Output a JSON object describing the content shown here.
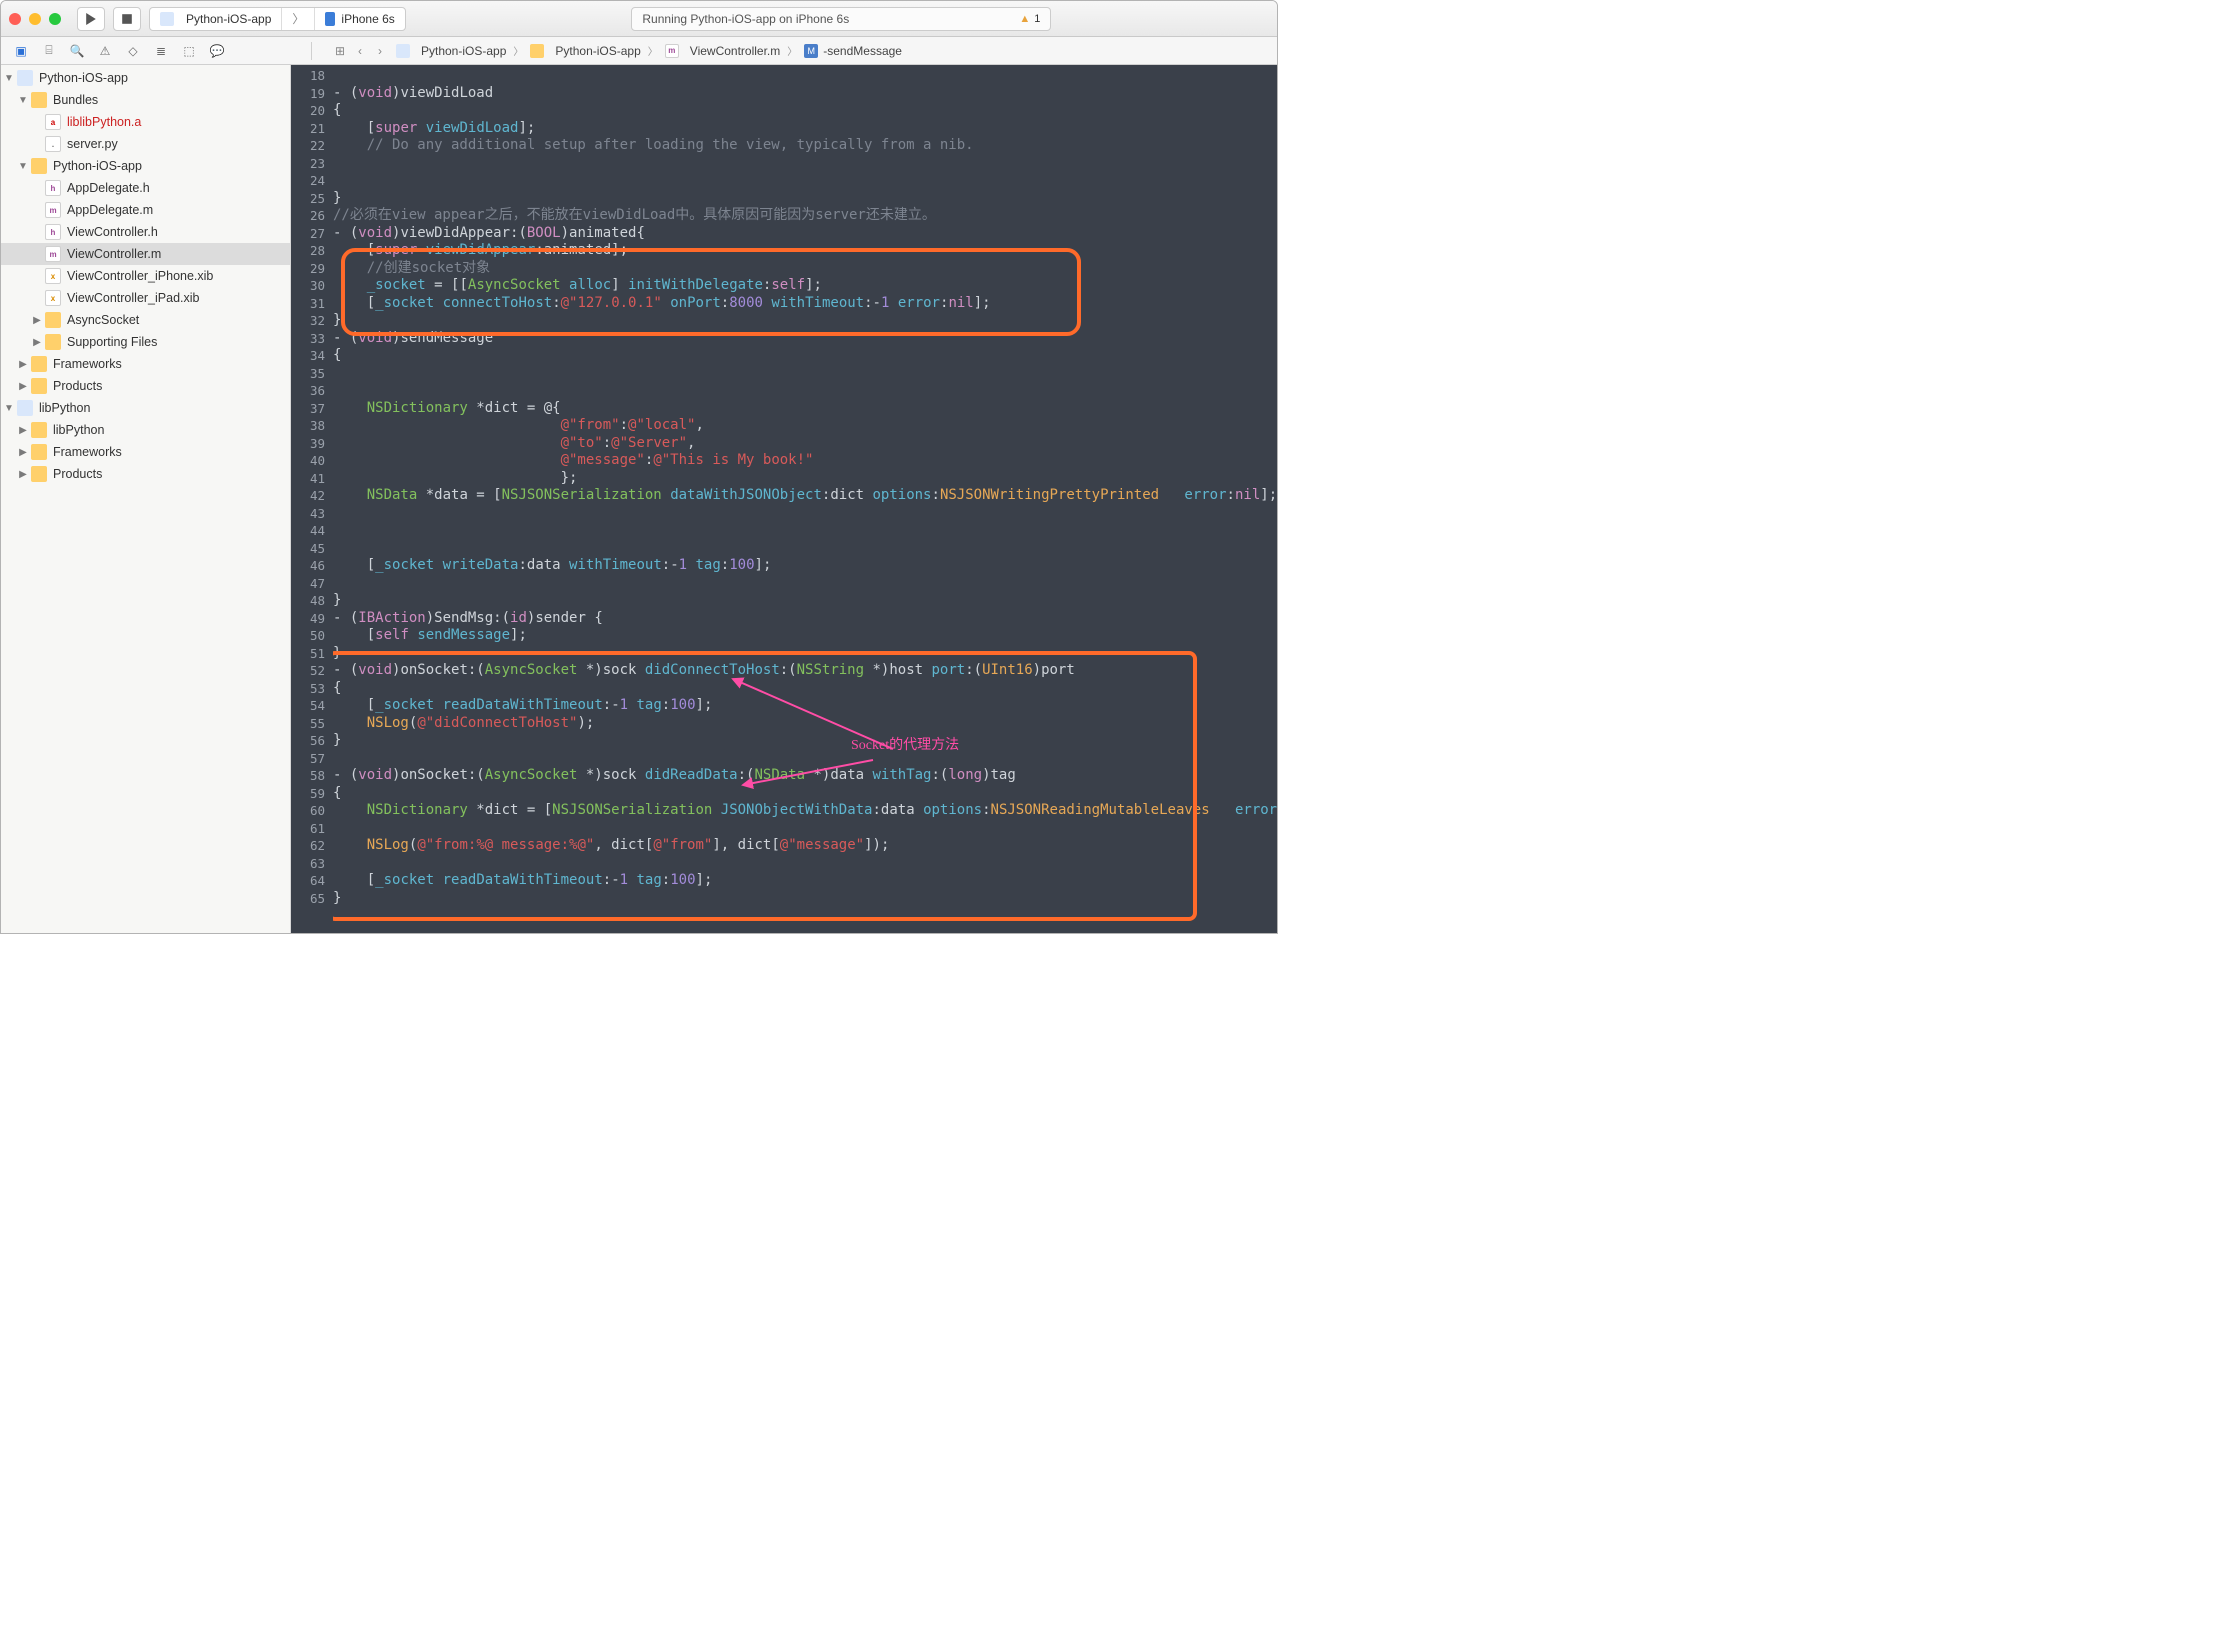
{
  "titlebar": {
    "scheme_app": "Python-iOS-app",
    "scheme_device": "iPhone 6s",
    "status_text": "Running Python-iOS-app on iPhone 6s",
    "warn_count": "1"
  },
  "jumpbar": {
    "levels": [
      "Python-iOS-app",
      "Python-iOS-app",
      "ViewController.m",
      "-sendMessage"
    ]
  },
  "tree": {
    "root": "Python-iOS-app",
    "bundles": "Bundles",
    "lib_a": "liblibPython.a",
    "server_py": "server.py",
    "app_folder": "Python-iOS-app",
    "appdelegate_h": "AppDelegate.h",
    "appdelegate_m": "AppDelegate.m",
    "viewcontroller_h": "ViewController.h",
    "viewcontroller_m": "ViewController.m",
    "vc_iphone_xib": "ViewController_iPhone.xib",
    "vc_ipad_xib": "ViewController_iPad.xib",
    "async_socket": "AsyncSocket",
    "supporting": "Supporting Files",
    "frameworks1": "Frameworks",
    "products1": "Products",
    "libpython_proj": "libPython",
    "libpython_folder": "libPython",
    "frameworks2": "Frameworks",
    "products2": "Products"
  },
  "gutter_start": 18,
  "annotation": "Socket的代理方法",
  "code_lines": [
    "",
    "- (<span class='c-key'>void</span>)viewDidLoad",
    "{",
    "    [<span class='c-key'>super</span> <span class='c-meth'>viewDidLoad</span>];",
    "    <span class='c-comm'>// Do any additional setup after loading the view, typically from a nib.</span>",
    "",
    "",
    "}",
    "<span class='c-comm'>//必须在view appear之后，不能放在viewDidLoad中。具体原因可能因为server还未建立。</span>",
    "- (<span class='c-key'>void</span>)viewDidAppear:(<span class='c-key'>BOOL</span>)animated{",
    "    [<span class='c-key'>super</span> <span class='c-meth'>viewDidAppear</span>:animated];",
    "    <span class='c-comm'>//创建socket对象</span>",
    "    <span class='c-meth'>_socket</span> = [[<span class='c-cls'>AsyncSocket</span> <span class='c-meth'>alloc</span>] <span class='c-meth'>initWithDelegate</span>:<span class='c-self'>self</span>];",
    "    [<span class='c-meth'>_socket</span> <span class='c-meth'>connectToHost</span>:<span class='c-str'>@\"127.0.0.1\"</span> <span class='c-meth'>onPort</span>:<span class='c-num'>8000</span> <span class='c-meth'>withTimeout</span>:-<span class='c-num'>1</span> <span class='c-meth'>error</span>:<span class='c-key'>nil</span>];",
    "}",
    "- (<span class='c-key'>void</span>)sendMessage",
    "{",
    "",
    "",
    "    <span class='c-cls'>NSDictionary</span> *dict = @{",
    "                           <span class='c-str'>@\"from\"</span>:<span class='c-str'>@\"local\"</span>,",
    "                           <span class='c-str'>@\"to\"</span>:<span class='c-str'>@\"Server\"</span>,",
    "                           <span class='c-str'>@\"message\"</span>:<span class='c-str'>@\"This is My book!\"</span>",
    "                           };",
    "    <span class='c-cls'>NSData</span> *data = [<span class='c-cls'>NSJSONSerialization</span> <span class='c-meth'>dataWithJSONObject</span>:dict <span class='c-meth'>options</span>:<span class='c-type'>NSJSONWritingPrettyPrinted</span>   <span class='c-meth'>error</span>:<span class='c-key'>nil</span>];",
    "",
    "",
    "",
    "    [<span class='c-meth'>_socket</span> <span class='c-meth'>writeData</span>:data <span class='c-meth'>withTimeout</span>:-<span class='c-num'>1</span> <span class='c-meth'>tag</span>:<span class='c-num'>100</span>];",
    "",
    "}",
    "- (<span class='c-key'>IBAction</span>)SendMsg:(<span class='c-key'>id</span>)sender {",
    "    [<span class='c-self'>self</span> <span class='c-meth'>sendMessage</span>];",
    "}",
    "- (<span class='c-key'>void</span>)onSocket:(<span class='c-cls'>AsyncSocket</span> *)sock <span class='c-meth'>didConnectToHost</span>:(<span class='c-cls'>NSString</span> *)host <span class='c-meth'>port</span>:(<span class='c-type'>UInt16</span>)port",
    "{",
    "    [<span class='c-meth'>_socket</span> <span class='c-meth'>readDataWithTimeout</span>:-<span class='c-num'>1</span> <span class='c-meth'>tag</span>:<span class='c-num'>100</span>];",
    "    <span class='c-type'>NSLog</span>(<span class='c-str'>@\"didConnectToHost\"</span>);",
    "}",
    "",
    "- (<span class='c-key'>void</span>)onSocket:(<span class='c-cls'>AsyncSocket</span> *)sock <span class='c-meth'>didReadData</span>:(<span class='c-cls'>NSData</span> *)data <span class='c-meth'>withTag</span>:(<span class='c-key'>long</span>)tag",
    "{",
    "    <span class='c-cls'>NSDictionary</span> *dict = [<span class='c-cls'>NSJSONSerialization</span> <span class='c-meth'>JSONObjectWithData</span>:data <span class='c-meth'>options</span>:<span class='c-type'>NSJSONReadingMutableLeaves</span>   <span class='c-meth'>error</span>:<span class='c-key'>nil</span>];",
    "",
    "    <span class='c-type'>NSLog</span>(<span class='c-str'>@\"from:%@ message:%@\"</span>, dict[<span class='c-str'>@\"from\"</span>], dict[<span class='c-str'>@\"message\"</span>]);",
    "",
    "    [<span class='c-meth'>_socket</span> <span class='c-meth'>readDataWithTimeout</span>:-<span class='c-num'>1</span> <span class='c-meth'>tag</span>:<span class='c-num'>100</span>];",
    "}"
  ]
}
